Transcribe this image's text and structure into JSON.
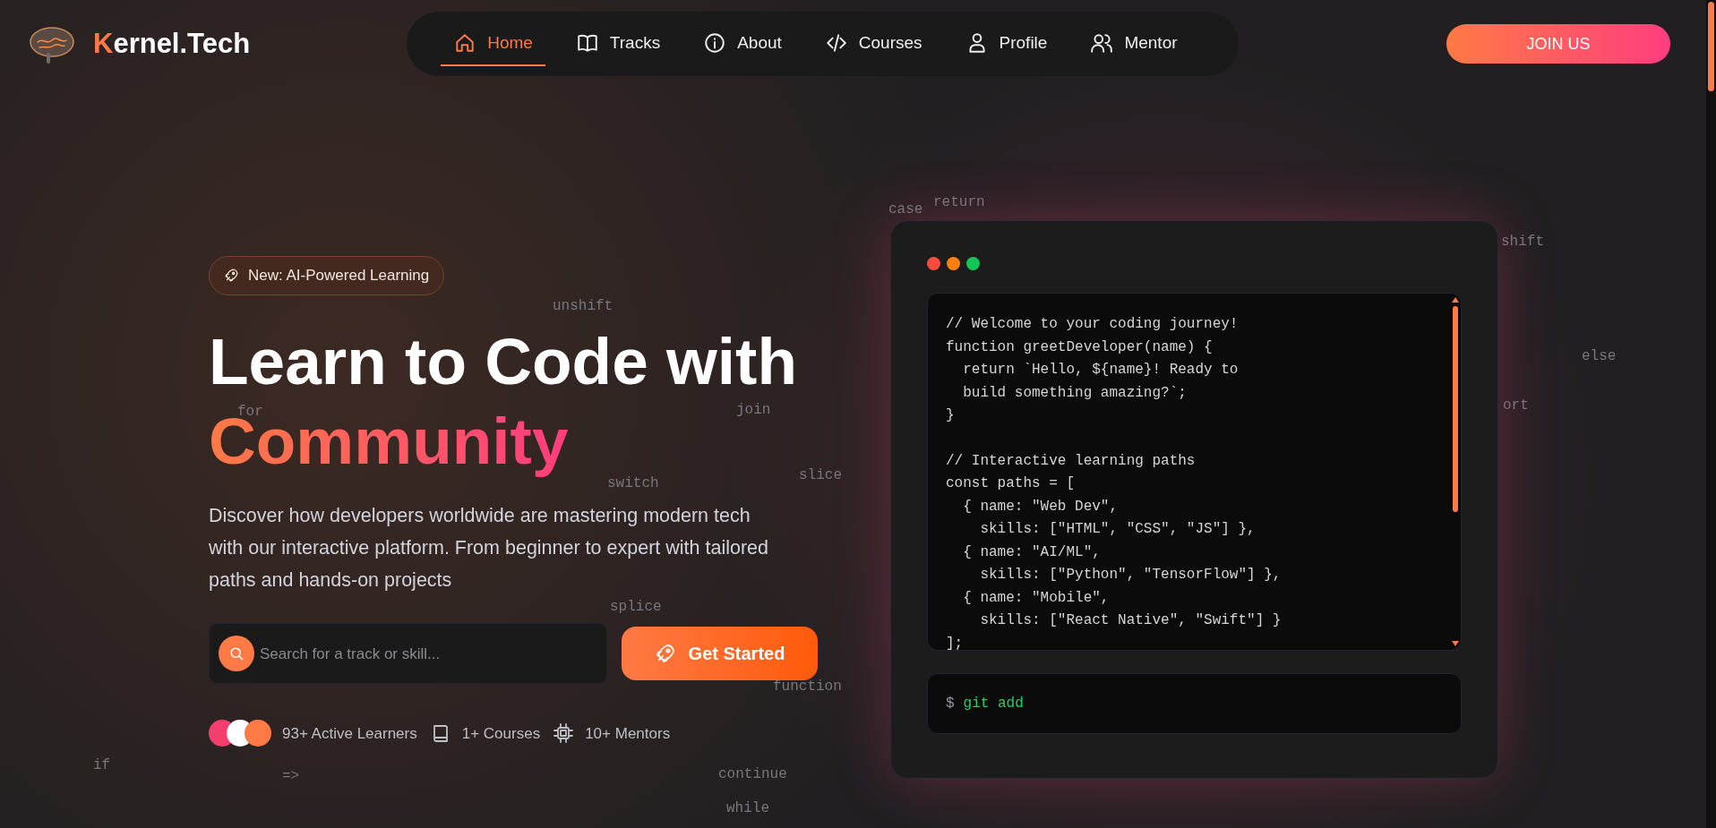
{
  "brand": {
    "name": "Kernel.Tech"
  },
  "nav": [
    {
      "label": "Home",
      "selected": true
    },
    {
      "label": "Tracks",
      "selected": false
    },
    {
      "label": "About",
      "selected": false
    },
    {
      "label": "Courses",
      "selected": false
    },
    {
      "label": "Profile",
      "selected": false
    },
    {
      "label": "Mentor",
      "selected": false
    }
  ],
  "join_button": "JOIN US",
  "hero": {
    "badge": "New: AI-Powered Learning",
    "title_line_1": "Learn to Code with",
    "title_line_2": "Community",
    "description": "Discover how developers worldwide are mastering modern tech with our interactive platform. From beginner to expert with tailored paths and hands-on projects",
    "search": {
      "placeholder": "Search for a track or skill..."
    },
    "cta": "Get Started",
    "avatars": [
      {
        "color": "#f43f6e"
      },
      {
        "color": "#ffffff"
      },
      {
        "color": "#ff7a45"
      }
    ],
    "stats": [
      {
        "kind": "learners",
        "text": "93+ Active Learners"
      },
      {
        "kind": "courses",
        "text": "1+ Courses"
      },
      {
        "kind": "mentors",
        "text": "10+ Mentors"
      }
    ]
  },
  "code_window": {
    "blocks": [
      {
        "lines": [
          "// Welcome to your coding journey!",
          "function greetDeveloper(name) {",
          "  return `Hello, ${name}! Ready to",
          "  build something amazing?`;",
          "}"
        ]
      },
      {
        "lines": [
          "// Interactive learning paths",
          "const paths = [",
          "  { name: \"Web Dev\",",
          "    skills: [\"HTML\", \"CSS\", \"JS\"] },",
          "  { name: \"AI/ML\",",
          "    skills: [\"Python\", \"TensorFlow\"] },",
          "  { name: \"Mobile\",",
          "    skills: [\"React Native\", \"Swift\"] }",
          "];"
        ]
      }
    ],
    "terminal": {
      "prompt": "$",
      "command": "git add"
    }
  },
  "floating_words": [
    {
      "text": "case"
    },
    {
      "text": "return"
    },
    {
      "text": "shift"
    },
    {
      "text": "else"
    },
    {
      "text": "ort"
    },
    {
      "text": "unshift"
    },
    {
      "text": "for"
    },
    {
      "text": "join"
    },
    {
      "text": "slice"
    },
    {
      "text": "switch"
    },
    {
      "text": "splice"
    },
    {
      "text": "function"
    },
    {
      "text": "if"
    },
    {
      "text": "=>"
    },
    {
      "text": "continue"
    },
    {
      "text": "while"
    }
  ]
}
